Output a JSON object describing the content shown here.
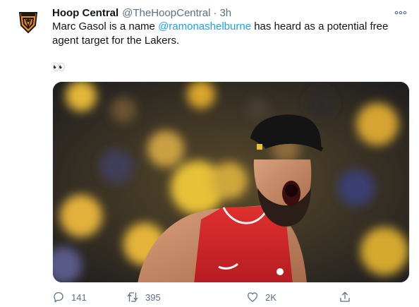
{
  "tweet": {
    "display_name": "Hoop Central",
    "handle": "@TheHoopCentral",
    "separator": "·",
    "time": "3h",
    "text_before_mention": "Marc Gasol is a name ",
    "mention": "@ramonashelburne",
    "text_after_mention": " has heard as a potential free agent target for the Lakers.",
    "emoji": "👀"
  },
  "media": {
    "icon": "photo-of-basketball-player-yelling"
  },
  "actions": {
    "reply_count": "141",
    "retweet_count": "395",
    "like_count": "2K"
  },
  "colors": {
    "mention": "#1da1f2",
    "muted": "#5b7083",
    "jersey_red": "#d6232a",
    "brand_orange": "#f08a1e"
  },
  "icons": {
    "more": "more-horizontal-icon",
    "reply": "reply-icon",
    "retweet": "retweet-icon",
    "like": "heart-icon",
    "share": "share-icon"
  }
}
